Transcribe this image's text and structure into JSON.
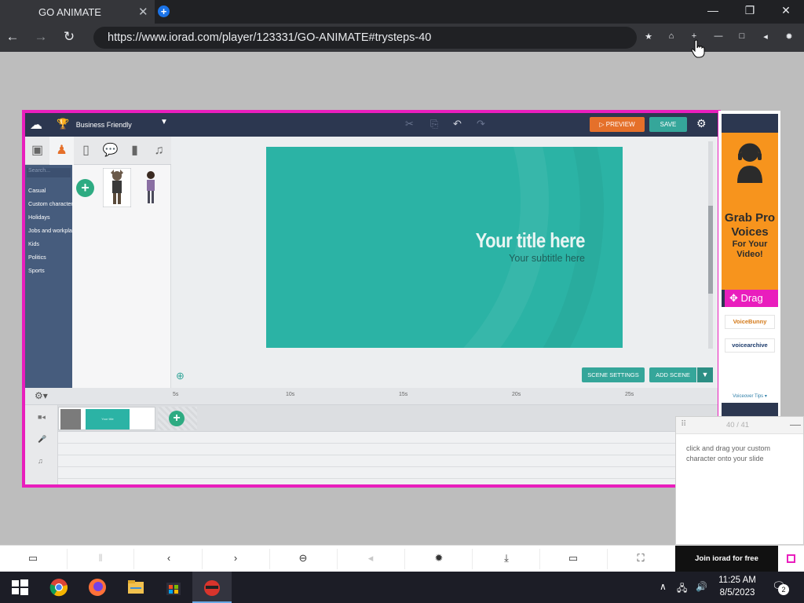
{
  "browser": {
    "tab_title": "GO ANIMATE",
    "tab_close": "✕",
    "new_tab": "+",
    "url": "https://www.iorad.com/player/123331/GO-ANIMATE#trysteps-40"
  },
  "app": {
    "theme_name": "Business Friendly",
    "preview_label": "PREVIEW",
    "save_label": "SAVE",
    "search_placeholder": "Search...",
    "categories": [
      "Casual",
      "Custom characters",
      "Holidays",
      "Jobs and workplace",
      "Kids",
      "Politics",
      "Sports"
    ],
    "stage_title": "Your title here",
    "stage_subtitle": "Your subtitle here",
    "scene_settings_label": "SCENE SETTINGS",
    "add_scene_label": "ADD SCENE",
    "timeline_ticks": [
      "5s",
      "10s",
      "15s",
      "20s",
      "25s"
    ],
    "clip_text": "Your title"
  },
  "ad": {
    "headline": "Grab Pro Voices",
    "subline": "For Your Video!",
    "drag_label": "Drag",
    "brands": [
      "VoiceBunny",
      "voicearchive"
    ],
    "tips_label": "Voiceover Tips ▾"
  },
  "step": {
    "counter": "40 / 41",
    "instruction": "click and drag your custom character onto your slide"
  },
  "player": {
    "join_label": "Join iorad for free"
  },
  "taskbar": {
    "time": "11:25 AM",
    "date": "8/5/2023",
    "notifications": "2"
  },
  "colors": {
    "accent_pink": "#e91ebd",
    "stage_teal": "#2bb3a5",
    "preview_orange": "#e5702a",
    "save_teal": "#35a69a",
    "header_navy": "#2c3750",
    "ad_orange": "#f7941d"
  }
}
